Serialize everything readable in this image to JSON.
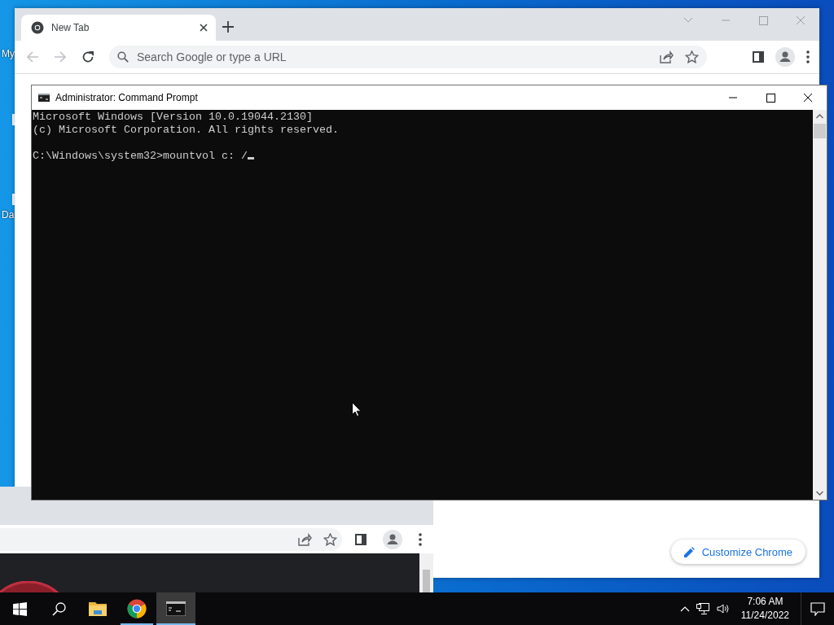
{
  "desktop": {
    "icons": [
      {
        "label": "My"
      },
      {
        "label": "Da"
      }
    ]
  },
  "browser": {
    "tabs": [
      {
        "title": "New Tab",
        "selected": true
      }
    ],
    "omnibox": {
      "placeholder": "Search Google or type a URL"
    },
    "customize_button": "Customize Chrome"
  },
  "console": {
    "title": "Administrator: Command Prompt",
    "output": [
      "Microsoft Windows [Version 10.0.19044.2130]",
      "(c) Microsoft Corporation. All rights reserved."
    ],
    "prompt": "C:\\Windows\\system32>",
    "input": "mountvol c: /"
  },
  "taskbar": {
    "apps": [
      {
        "kind": "start",
        "running": false,
        "selected": false
      },
      {
        "kind": "search",
        "running": false,
        "selected": false
      },
      {
        "kind": "explorer",
        "running": false,
        "selected": false
      },
      {
        "kind": "chrome",
        "running": true,
        "selected": false
      },
      {
        "kind": "terminal",
        "running": true,
        "selected": true
      }
    ],
    "clock": {
      "time": "7:06 AM",
      "date": "11/24/2022"
    }
  }
}
